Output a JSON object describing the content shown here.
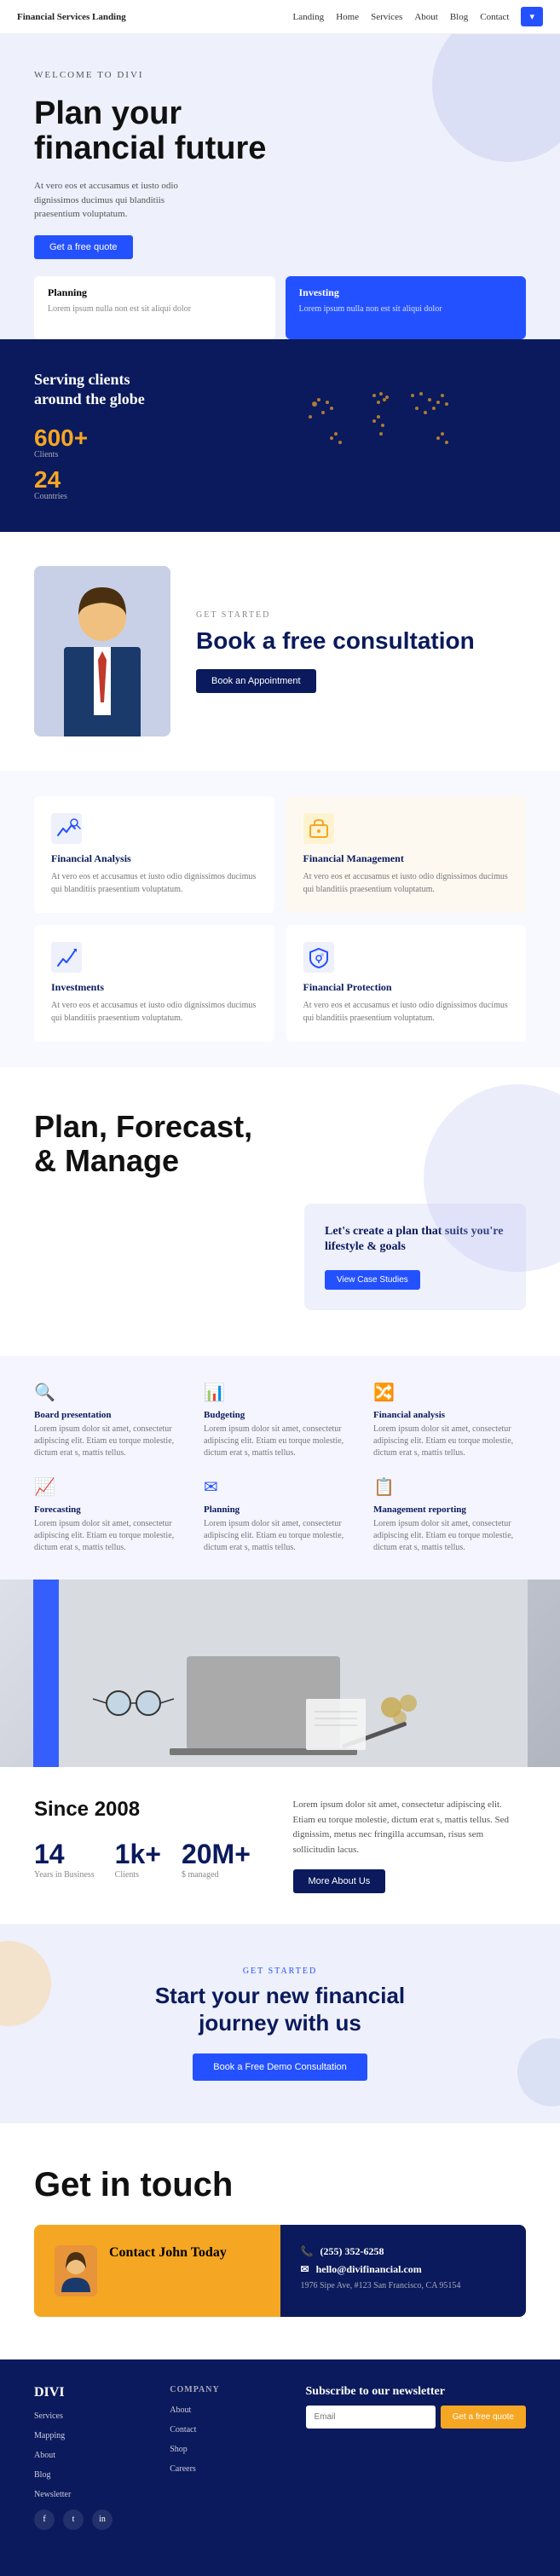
{
  "site": {
    "title": "Financial Services Landing"
  },
  "nav": {
    "logo": "Financial Services Landing",
    "links": [
      "Landing",
      "Home",
      "Services",
      "About",
      "Blog",
      "Contact"
    ],
    "cta_label": "▾"
  },
  "hero": {
    "welcome": "WELCOME TO DIVI",
    "title": "Plan your financial future",
    "description": "At vero eos et accusamus et iusto odio dignissimos ducimus qui blanditiis praesentium voluptatum.",
    "cta_label": "Get a free quote",
    "card1_title": "Planning",
    "card1_text": "Lorem ipsum nulla non est sit aliqui dolor",
    "card2_title": "Investing",
    "card2_text": "Lorem ipsum nulla non est sit aliqui dolor"
  },
  "stats": {
    "heading": "Serving clients around the globe",
    "clients_num": "600+",
    "clients_label": "Clients",
    "countries_num": "24",
    "countries_label": "Countries"
  },
  "consultation": {
    "label": "GET STARTED",
    "title": "Book a free consultation",
    "btn_label": "Book an Appointment"
  },
  "services": {
    "items": [
      {
        "title": "Financial Analysis",
        "text": "At vero eos et accusamus et iusto odio dignissimos ducimus qui blanditiis praesentium voluptatum.",
        "color": "white",
        "icon": "chart"
      },
      {
        "title": "Financial Management",
        "text": "At vero eos et accusamus et iusto odio dignissimos ducimus qui blanditiis praesentium voluptatum.",
        "color": "yellow",
        "icon": "briefcase"
      },
      {
        "title": "Investments",
        "text": "At vero eos et accusamus et iusto odio dignissimos ducimus qui blanditiis praesentium voluptatum.",
        "color": "white",
        "icon": "growth"
      },
      {
        "title": "Financial Protection",
        "text": "At vero eos et accusamus et iusto odio dignissimos ducimus qui blanditiis praesentium voluptatum.",
        "color": "white",
        "icon": "shield"
      }
    ]
  },
  "plan": {
    "title": "Plan, Forecast, & Manage",
    "card_title": "Let's create a plan that suits you're lifestyle & goals",
    "card_btn": "View Case Studies"
  },
  "features": {
    "items": [
      {
        "icon": "🔍",
        "title": "Board presentation",
        "text": "Lorem ipsum dolor sit amet, consectetur adipiscing elit. Etiam eu torque molestie, dictum erat s, mattis tellus."
      },
      {
        "icon": "📊",
        "title": "Budgeting",
        "text": "Lorem ipsum dolor sit amet, consectetur adipiscing elit. Etiam eu torque molestie, dictum erat s, mattis tellus."
      },
      {
        "icon": "🔀",
        "title": "Financial analysis",
        "text": "Lorem ipsum dolor sit amet, consectetur adipiscing elit. Etiam eu torque molestie, dictum erat s, mattis tellus."
      },
      {
        "icon": "📈",
        "title": "Forecasting",
        "text": "Lorem ipsum dolor sit amet, consectetur adipiscing elit. Etiam eu torque molestie, dictum erat s, mattis tellus."
      },
      {
        "icon": "✉",
        "title": "Planning",
        "text": "Lorem ipsum dolor sit amet, consectetur adipiscing elit. Etiam eu torque molestie, dictum erat s, mattis tellus."
      },
      {
        "icon": "📋",
        "title": "Management reporting",
        "text": "Lorem ipsum dolor sit amet, consectetur adipiscing elit. Etiam eu torque molestie, dictum erat s, mattis tellus."
      }
    ]
  },
  "since": {
    "heading": "Since 2008",
    "num1": "14",
    "label1": "Years in Business",
    "num2": "1k+",
    "label2": "Clients",
    "num3": "20M+",
    "label3": "$ managed",
    "description": "Lorem ipsum dolor sit amet, consectetur adipiscing elit. Etiam eu torque molestie, dictum erat s, mattis tellus. Sed dignissim, metus nec fringilla accumsan, risus sem sollicitudin lacus.",
    "btn_label": "More About Us"
  },
  "cta": {
    "label": "GET STARTED",
    "title": "Start your new financial journey with us",
    "btn_label": "Book a Free Demo Consultation"
  },
  "contact": {
    "heading": "Get in touch",
    "name": "Contact John Today",
    "phone": "(255) 352-6258",
    "email": "hello@divifinancial.com",
    "address": "1976 Sipe Ave, #123 San Francisco, CA 95154"
  },
  "footer": {
    "brand": "DIVI",
    "col1_links": [
      "Services",
      "Mapping",
      "About",
      "Blog",
      "Newsletter"
    ],
    "col2_label": "COMPANY",
    "col2_links": [
      "About",
      "Contact",
      "Shop",
      "Careers"
    ],
    "newsletter_title": "Subscribe to our newsletter",
    "newsletter_placeholder": "Email",
    "newsletter_btn": "Get a free quote"
  }
}
